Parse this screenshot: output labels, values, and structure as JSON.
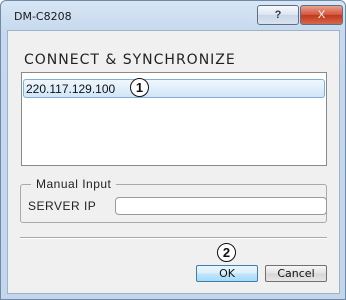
{
  "window": {
    "title": "DM-C8208",
    "help_label": "?",
    "close_label": "X"
  },
  "connect": {
    "heading": "CONNECT & SYNCHRONIZE",
    "items": [
      {
        "label": "220.117.129.100"
      }
    ]
  },
  "manual_input": {
    "legend": "Manual Input",
    "server_ip_label": "SERVER IP",
    "server_ip_value": "",
    "server_ip_placeholder": ""
  },
  "buttons": {
    "ok_label": "OK",
    "cancel_label": "Cancel"
  },
  "annotations": {
    "callout_1": "1",
    "callout_2": "2"
  },
  "colors": {
    "selection_border": "#7eb0d8",
    "close_button": "#c2381d"
  }
}
